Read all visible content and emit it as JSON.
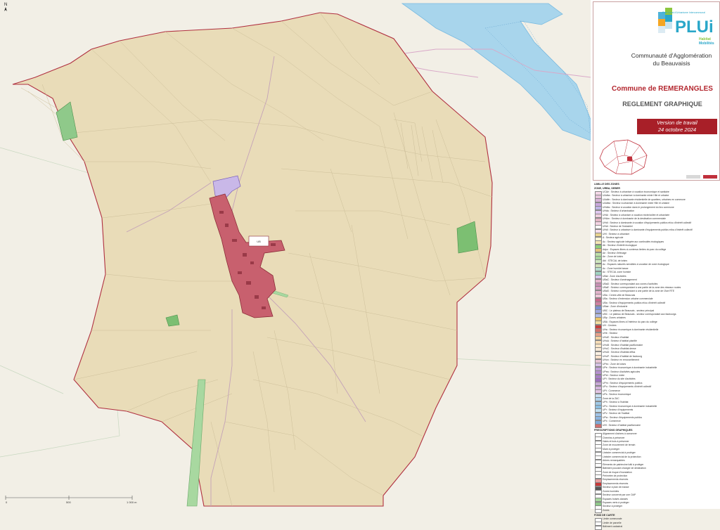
{
  "map": {
    "north_label": "N",
    "scale_labels": [
      "0",
      "500",
      "1 000 m"
    ]
  },
  "title_block": {
    "logo_main": "PLUi",
    "logo_tagline": "Plan Local d'Urbanisme Intercommunal",
    "logo_sub": [
      "Habitat",
      "Mobilités"
    ],
    "agglomeration_line1": "Communauté d'Agglomération",
    "agglomeration_line2": "du Beauvaisis",
    "commune": "Commune de REMERANGLES",
    "document": "REGLEMENT GRAPHIQUE",
    "version_line1": "Version de travail",
    "version_line2": "24 octobre 2024"
  },
  "zone_labels": {
    "village_zone": "UB",
    "east_zone": "UHa"
  },
  "legend": {
    "section_titles": [
      "LIMILLE DES ZONES",
      "ZONE, URBA, DEBER",
      "PRESCRIPTIONS GRAPHIQUES",
      "FOND DE CARTE"
    ],
    "zone_items": [
      {
        "color": "#f4d9e8",
        "text": "UCAe : Secteur à urbaniser à vocation économique et sanitaire"
      },
      {
        "color": "#e8c7de",
        "text": "UAdba : Secteur à urbaniser à dominante mixte Hlle et urbaine"
      },
      {
        "color": "#d8b3d8",
        "text": "UAdbh : Secteur à dominante résidentielle de quartiers, urbaines en commune"
      },
      {
        "color": "#c9a7dd",
        "text": "UAdbia : Secteur à urbaniser à dominante mixte Hlle et urbaine"
      },
      {
        "color": "#bfb5e6",
        "text": "UHdbs : Secteur à vocation dans le prolongement du lieu commune"
      },
      {
        "color": "#e0c8f0",
        "text": "UHda : Secteur d'urbanisation"
      },
      {
        "color": "#f0d0e0",
        "text": "UHAi : Secteur à urbaniser à vocation mixte/voilée et urbanisée"
      },
      {
        "color": "#e5b8c8",
        "text": "UHAm : Secteur à dominante de la destination commerciale"
      },
      {
        "color": "#f5d5e5",
        "text": "UHdi : Secteur à dominante à vocation d'équipements publics et/ou d'intérêt collectif"
      },
      {
        "color": "#ffffff",
        "text": "UHdi : Secteur de l'industriel"
      },
      {
        "color": "#f7e0ee",
        "text": "UHdl : Secteur à urbaniser à dominante d'équipements publics et/ou d'intérêt collectif"
      },
      {
        "color": "#e8d38e",
        "text": "UHI : Secteur à urbaniser"
      },
      {
        "color": "#fff6d8",
        "text": "A : Secteur agricole"
      },
      {
        "color": "#f5e6b3",
        "text": "Ac : Secteur agricole intégrée aux continuités écologiques"
      },
      {
        "color": "#8fcf7a",
        "text": "Ab : Secteur d'intérêt écologique"
      },
      {
        "color": "#e5c27a",
        "text": "Adpo : Espaces libres ci-contenus limites du parc du collège"
      },
      {
        "color": "#bde0a8",
        "text": "Ae : Secteur d'élevage"
      },
      {
        "color": "#a5d39c",
        "text": "Ae : Zone de loisirs"
      },
      {
        "color": "#cfe8c0",
        "text": "Abl : STECAL de loisirs"
      },
      {
        "color": "#d2e0b8",
        "text": "Ac : Espaces naturels sensibles à vocation de zone écologique"
      },
      {
        "color": "#b8ddd0",
        "text": "Ac : Zone humide basse"
      },
      {
        "color": "#9fd4c2",
        "text": "Ac : STECAL zone humide"
      },
      {
        "color": "#d9c7ee",
        "text": "UBal : Zone d'activités"
      },
      {
        "color": "#e8b7cf",
        "text": "UBaC : Secteur d'aménagement"
      },
      {
        "color": "#c78fb3",
        "text": "UBaD : Secteur correspondant aux zones d'activités"
      },
      {
        "color": "#d6a3c5",
        "text": "UBaE : Secteur correspondant à une partie de la zone des réseaux routes"
      },
      {
        "color": "#e3b4cc",
        "text": "UBaS : Secteur correspondant à une partie de la zone de l'Axe RTE"
      },
      {
        "color": "#f0c8da",
        "text": "UBa : Centre-ville de Beauvais"
      },
      {
        "color": "#c86a8c",
        "text": "UBa : Secteur d'extension urbaine commerciale"
      },
      {
        "color": "#cf7fa0",
        "text": "UBa : Secteur d'équipements publics et/ou d'intérêt collectif"
      },
      {
        "color": "#7b8fd0",
        "text": "UBae : Zone d'industrie"
      },
      {
        "color": "#9fa8e0",
        "text": "UBC : Le plateau de Beauvais - secteur principal"
      },
      {
        "color": "#b2bde8",
        "text": "UBC : Le plateau de Beauvais - secteur correspondant aux faubourgs"
      },
      {
        "color": "#e9c36a",
        "text": "UBp : Zones urbaines"
      },
      {
        "color": "#f2dda0",
        "text": "UBA : Espaces libres à l'intérieur du parc du collège"
      },
      {
        "color": "#c5403e",
        "text": "UH : Centres"
      },
      {
        "color": "#d2706a",
        "text": "UHa : Secteur économique à dominante résidentielle"
      },
      {
        "color": "#e7a08a",
        "text": "UHb : Secteur"
      },
      {
        "color": "#f2d1a2",
        "text": "UHoE : Secteur d'habitat"
      },
      {
        "color": "#f6dcb6",
        "text": "UHoA : Secteur d'habitat planifié"
      },
      {
        "color": "#fbe6c8",
        "text": "UHoB : Secteur d'habitat pavillonnaire"
      },
      {
        "color": "#f9ead8",
        "text": "UHoC : Secteur d'habitat dense"
      },
      {
        "color": "#fdf1e4",
        "text": "UHoD : Secteur d'habitat diffus"
      },
      {
        "color": "#fbe1cc",
        "text": "UHoP : Secteur d'habitat de faubourg"
      },
      {
        "color": "#e8c6d6",
        "text": "UHon : Secteur en renouvellement"
      },
      {
        "color": "#d6c2e6",
        "text": "UPec : Zone de loisirs"
      },
      {
        "color": "#c2a3d9",
        "text": "UPe : Secteur économique à dominante industrielle"
      },
      {
        "color": "#b590cf",
        "text": "UPea : Secteur d'activités agricoles"
      },
      {
        "color": "#a87fc6",
        "text": "UPet : Secteur mixte"
      },
      {
        "color": "#9d70bd",
        "text": "UPi : Secteur du site d'activités"
      },
      {
        "color": "#c7a8d6",
        "text": "UPm : Secteur d'équipements publics"
      },
      {
        "color": "#d3b5dd",
        "text": "UPu : Secteur d'équipements d'intérêt collectif"
      },
      {
        "color": "#e2c5e4",
        "text": "UPt : Commerce"
      },
      {
        "color": "#c8dff0",
        "text": "UPs : Secteur économique"
      },
      {
        "color": "#b3d4ec",
        "text": "Zone de la ZAC"
      },
      {
        "color": "#9fc9e6",
        "text": "UPh : Secteur à l'habitat"
      },
      {
        "color": "#8cbde0",
        "text": "UPo : Secteur économique à dominante industrielle"
      },
      {
        "color": "#c2e0f2",
        "text": "UPr : Secteur d'équipements"
      },
      {
        "color": "#a0c4e8",
        "text": "UPv : Secteur de l'habitat"
      },
      {
        "color": "#8db5e0",
        "text": "UPw : Secteur d'équipements publics"
      },
      {
        "color": "#7fa9d8",
        "text": "UPx : Commerce"
      },
      {
        "color": "#d06f6f",
        "text": "UHI : Secteur d'habitat pavillonnaire"
      }
    ],
    "prescription_items": [
      {
        "color": "#ffffff",
        "text": "Alignement d'arbres à conserver"
      },
      {
        "color": "#ffffff",
        "text": "Chemins à préserver"
      },
      {
        "color": "#ffffff",
        "text": "Haies et bois à préserver"
      },
      {
        "color": "#ffffff",
        "text": "Zone de mouvement de terrain"
      },
      {
        "color": "#ffffff",
        "text": "Mare à protéger"
      },
      {
        "color": "#ffffff",
        "text": "Linéaire commercial à protéger"
      },
      {
        "color": "#ffffff",
        "text": "Linéaire commercial de la protection"
      },
      {
        "color": "#ffffff",
        "text": "Arbres remarquables"
      },
      {
        "color": "#ffffff",
        "text": "Éléments de patrimoine bâti à protéger"
      },
      {
        "color": "#ffffff",
        "text": "Bâtiment pouvant changer de destination"
      },
      {
        "color": "#ffffff",
        "text": "Zone de risque d'inondation"
      },
      {
        "color": "#ffffff",
        "text": "Périmètre de protection"
      },
      {
        "color": "#e8a0a0",
        "text": "Emplacements réservés"
      },
      {
        "color": "#c83838",
        "text": "Emplacements réservés"
      },
      {
        "color": "#555555",
        "text": "Secteur à plan de masse"
      },
      {
        "color": "#ffffff",
        "text": "Zones humides"
      },
      {
        "color": "#ffffff",
        "text": "Secteur concerné par une OAP"
      },
      {
        "color": "#a8d8a0",
        "text": "Espaces boisés classés"
      },
      {
        "color": "#8fc98a",
        "text": "Espaces verts à protéger"
      },
      {
        "color": "#ffffff",
        "text": "Secteur à protéger"
      },
      {
        "color": "#ffffff",
        "text": "Zones"
      }
    ],
    "background_items": [
      {
        "color": "#ffffff",
        "text": "Limite communale"
      },
      {
        "color": "#ffffff",
        "text": "Limite de parcelle"
      },
      {
        "color": "#ffffff",
        "text": "Bâtiment cadastral"
      }
    ]
  }
}
